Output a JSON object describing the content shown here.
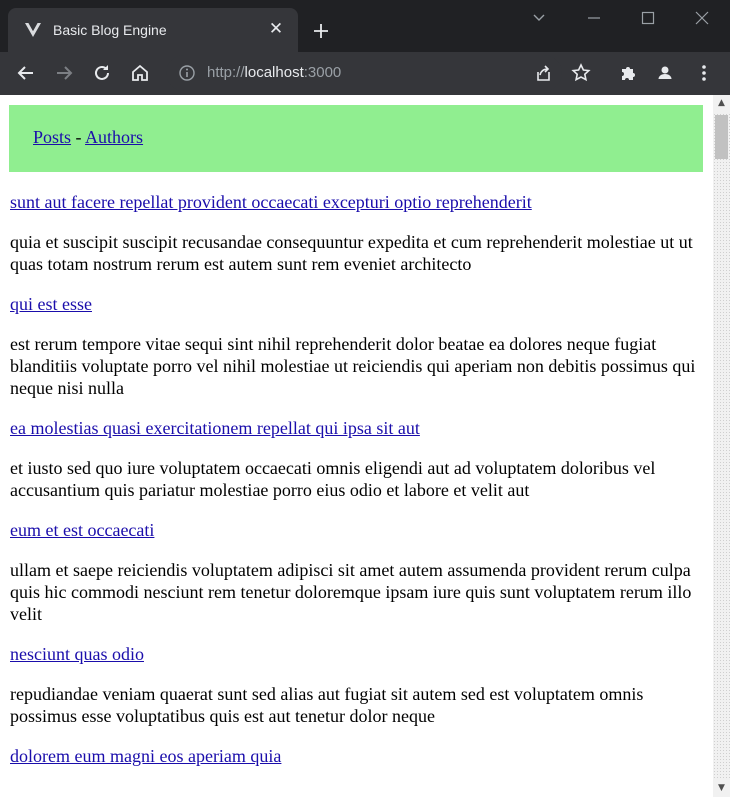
{
  "browser": {
    "tab_title": "Basic Blog Engine",
    "url_scheme": "http://",
    "url_host": "localhost",
    "url_port": ":3000"
  },
  "nav": {
    "posts_label": "Posts",
    "separator": "-",
    "authors_label": "Authors",
    "background": "#90ee90"
  },
  "posts": [
    {
      "title": "sunt aut facere repellat provident occaecati excepturi optio reprehenderit",
      "body": "quia et suscipit suscipit recusandae consequuntur expedita et cum reprehenderit molestiae ut ut quas totam nostrum rerum est autem sunt rem eveniet architecto"
    },
    {
      "title": "qui est esse",
      "body": "est rerum tempore vitae sequi sint nihil reprehenderit dolor beatae ea dolores neque fugiat blanditiis voluptate porro vel nihil molestiae ut reiciendis qui aperiam non debitis possimus qui neque nisi nulla"
    },
    {
      "title": "ea molestias quasi exercitationem repellat qui ipsa sit aut",
      "body": "et iusto sed quo iure voluptatem occaecati omnis eligendi aut ad voluptatem doloribus vel accusantium quis pariatur molestiae porro eius odio et labore et velit aut"
    },
    {
      "title": "eum et est occaecati",
      "body": "ullam et saepe reiciendis voluptatem adipisci sit amet autem assumenda provident rerum culpa quis hic commodi nesciunt rem tenetur doloremque ipsam iure quis sunt voluptatem rerum illo velit"
    },
    {
      "title": "nesciunt quas odio",
      "body": "repudiandae veniam quaerat sunt sed alias aut fugiat sit autem sed est voluptatem omnis possimus esse voluptatibus quis est aut tenetur dolor neque"
    },
    {
      "title": "dolorem eum magni eos aperiam quia",
      "body": ""
    }
  ],
  "icons": {
    "tab_favicon": "vue-logo-icon",
    "back": "arrow-left-icon",
    "forward": "arrow-right-icon",
    "reload": "reload-icon",
    "home": "home-icon",
    "site_info": "info-icon",
    "share": "share-icon",
    "bookmark": "star-icon",
    "extensions": "puzzle-icon",
    "profile": "person-icon",
    "menu": "kebab-menu-icon"
  }
}
